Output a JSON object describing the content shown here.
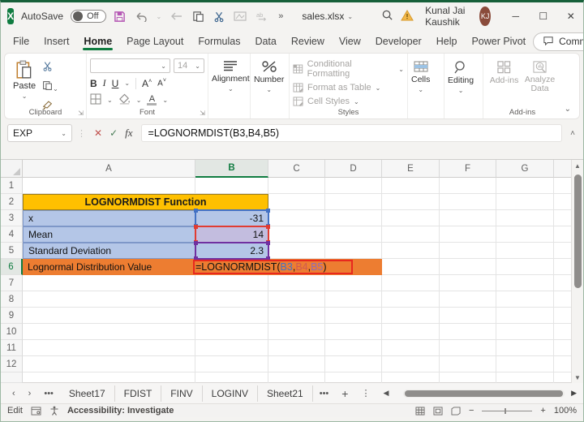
{
  "window": {
    "file_name": "sales.xlsx",
    "autosave_label": "AutoSave",
    "autosave_state": "Off",
    "user_name": "Kunal Jai Kaushik",
    "user_initials": "KJ"
  },
  "tabs": {
    "items": [
      "File",
      "Insert",
      "Home",
      "Page Layout",
      "Formulas",
      "Data",
      "Review",
      "View",
      "Developer",
      "Help",
      "Power Pivot"
    ],
    "active": "Home",
    "comments_label": "Comments"
  },
  "ribbon": {
    "paste": "Paste",
    "clipboard_group": "Clipboard",
    "font_size": "14",
    "font_group": "Font",
    "bold": "B",
    "italic": "I",
    "underline": "U",
    "grow_font": "A",
    "shrink_font": "A",
    "font_color": "A",
    "alignment": "Alignment",
    "number": "Number",
    "conditional_formatting": "Conditional Formatting",
    "format_as_table": "Format as Table",
    "cell_styles": "Cell Styles",
    "styles_group": "Styles",
    "cells": "Cells",
    "editing": "Editing",
    "addins": "Add-ins",
    "analyze_data": "Analyze Data",
    "addins_group": "Add-ins"
  },
  "formula_bar": {
    "name_box": "EXP",
    "formula": "=LOGNORMDIST(B3,B4,B5)"
  },
  "sheet": {
    "columns": [
      "A",
      "B",
      "C",
      "D",
      "E",
      "F",
      "G"
    ],
    "rows": [
      "1",
      "2",
      "3",
      "4",
      "5",
      "6",
      "7",
      "8",
      "9",
      "10",
      "11",
      "12"
    ],
    "title": "LOGNORMDIST Function",
    "row3": {
      "label": "x",
      "value": "-31"
    },
    "row4": {
      "label": "Mean",
      "value": "14"
    },
    "row5": {
      "label": "Standard Deviation",
      "value": "2.3"
    },
    "row6": {
      "label": "Lognormal Distribution Value"
    },
    "formula_cell": {
      "head": "=LOGNORMDIST(",
      "ref1": "B3",
      "sep1": ",",
      "ref2": "B4",
      "sep2": ",",
      "ref3": "B5",
      "tail": ")"
    }
  },
  "sheet_tabs": [
    "Sheet17",
    "FDIST",
    "FINV",
    "LOGINV",
    "Sheet21"
  ],
  "status_bar": {
    "mode": "Edit",
    "accessibility": "Accessibility: Investigate",
    "zoom": "100%"
  },
  "colors": {
    "excel_green": "#107C41",
    "header_gold": "#FFC000",
    "row_blue": "#B4C6E7",
    "result_orange": "#ED7D31",
    "ref_blue": "#4472C4",
    "ref_red": "#D05A50",
    "ref_purple": "#8E6BB8",
    "avatar_brown": "#8A4B3B"
  }
}
